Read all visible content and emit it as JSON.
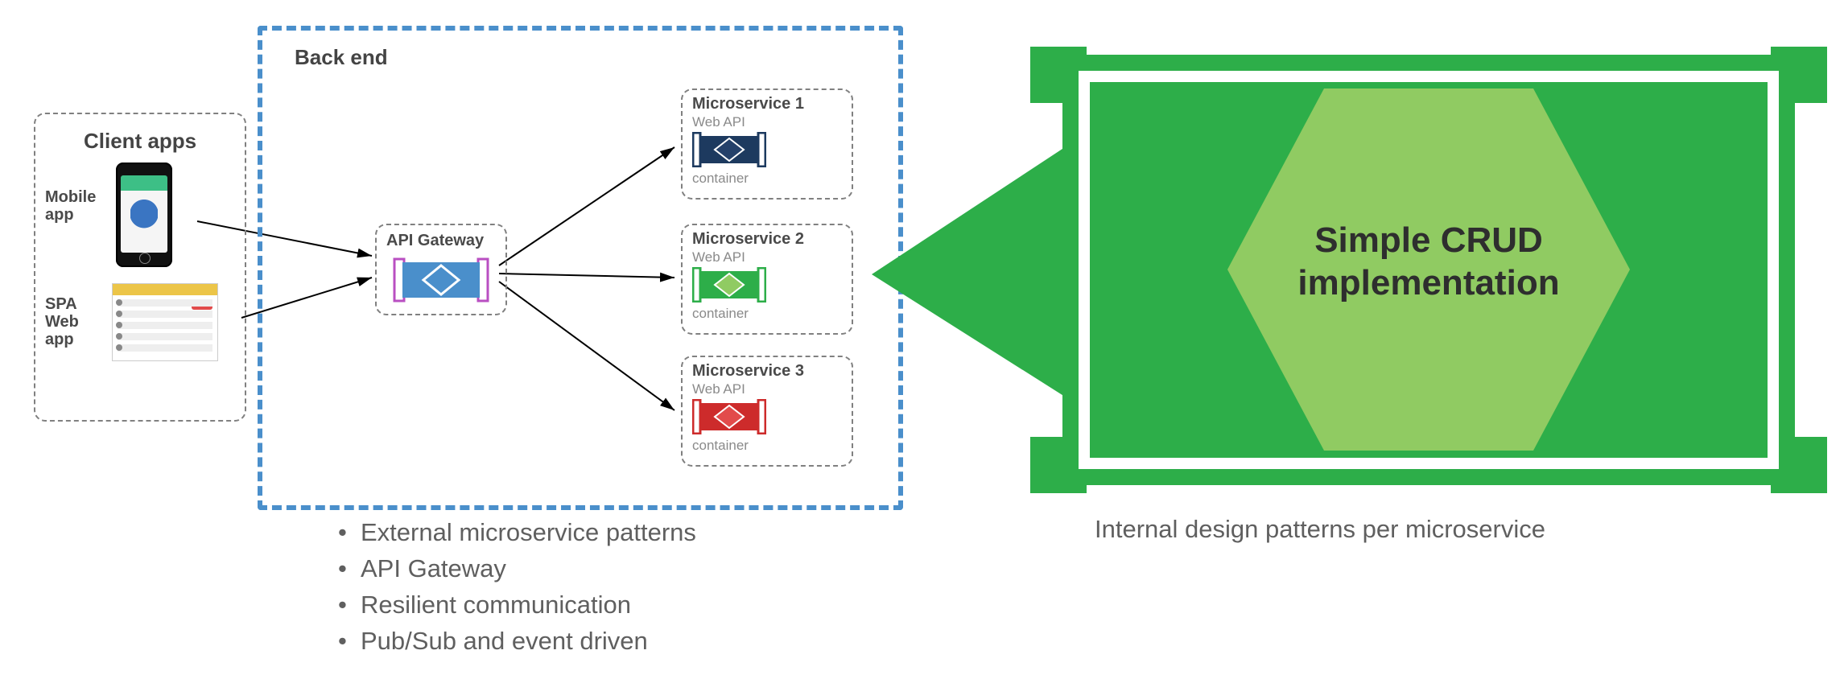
{
  "client_box": {
    "title": "Client apps",
    "mobile_label": "Mobile\napp",
    "spa_label": "SPA\nWeb\napp"
  },
  "backend_box": {
    "title": "Back end"
  },
  "api_gateway": {
    "title": "API Gateway"
  },
  "microservices": [
    {
      "title": "Microservice 1",
      "api": "Web API",
      "sub": "container",
      "color": "#1d3a5f",
      "hex": "#24416a"
    },
    {
      "title": "Microservice 2",
      "api": "Web API",
      "sub": "container",
      "color": "#2DAE49",
      "hex": "#90CB62"
    },
    {
      "title": "Microservice 3",
      "api": "Web API",
      "sub": "container",
      "color": "#CD2B2B",
      "hex": "#e24b4b"
    }
  ],
  "bullets": [
    "External microservice patterns",
    "API Gateway",
    "Resilient communication",
    "Pub/Sub and event driven"
  ],
  "crud": {
    "line1": "Simple CRUD",
    "line2": "implementation"
  },
  "caption_right": "Internal design patterns per microservice"
}
